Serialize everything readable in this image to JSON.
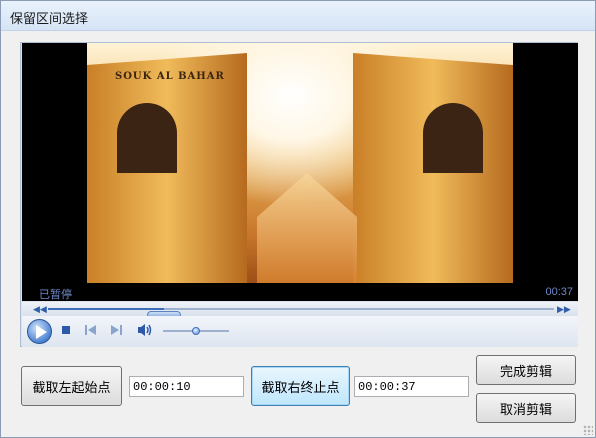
{
  "window": {
    "title": "保留区间选择"
  },
  "video": {
    "sign_text": "SOUK AL BAHAR",
    "state_label": "已暂停",
    "time_label": "00:37"
  },
  "seek": {
    "progress": 0.23
  },
  "volume": {
    "level": 0.5
  },
  "controls": {
    "icons": [
      "play-icon",
      "stop-icon",
      "previous-icon",
      "next-icon",
      "volume-icon"
    ]
  },
  "actions": {
    "set_start_label": "截取左起始点",
    "start_value": "00:00:10",
    "set_end_label": "截取右终止点",
    "end_value": "00:00:37",
    "finish_label": "完成剪辑",
    "cancel_label": "取消剪辑"
  },
  "colors": {
    "accent": "#3d6db8",
    "status_text": "#6f88c9"
  }
}
